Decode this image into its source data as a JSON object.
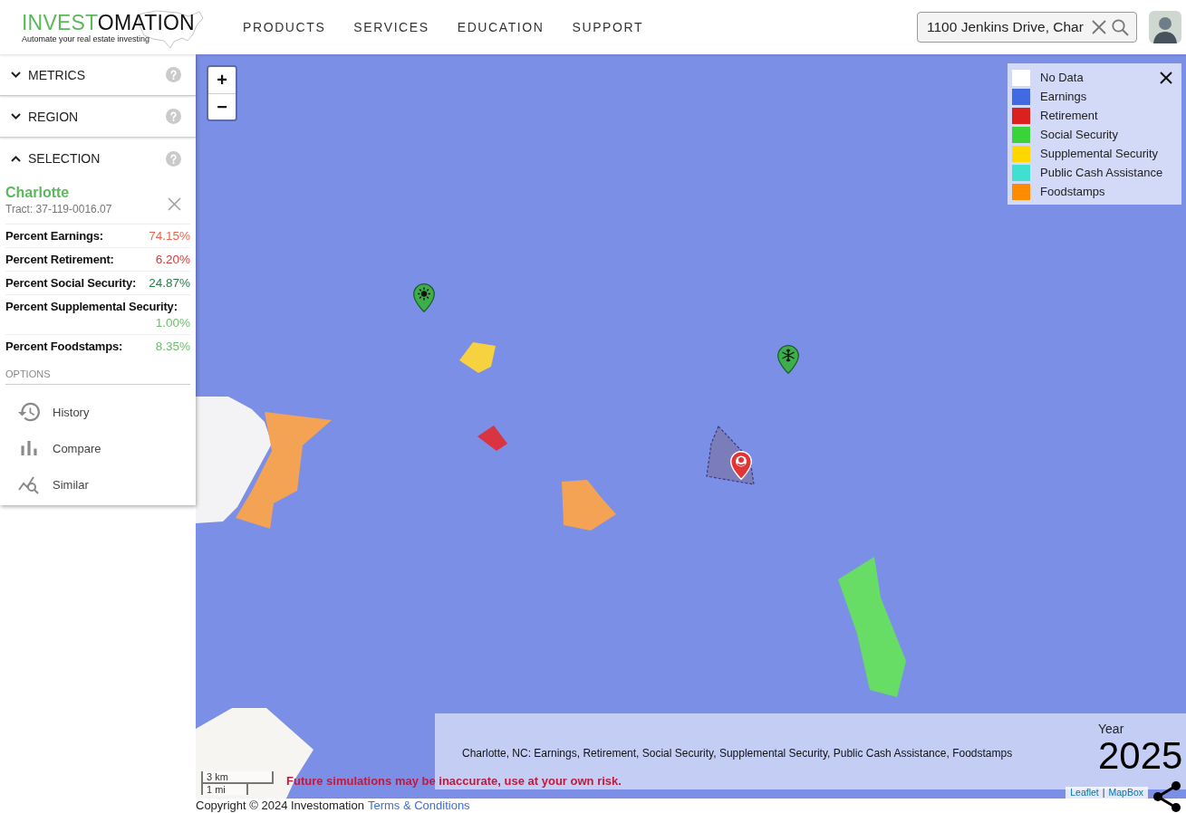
{
  "header": {
    "logo": {
      "wordmark_accent": "INVEST",
      "wordmark_rest": "OMATION",
      "tagline": "Automate your real estate investing"
    },
    "nav": [
      {
        "label": "PRODUCTS"
      },
      {
        "label": "SERVICES"
      },
      {
        "label": "EDUCATION"
      },
      {
        "label": "SUPPORT"
      }
    ],
    "search": {
      "value": "1100 Jenkins Drive, Char"
    }
  },
  "sidebar": {
    "sections": [
      {
        "label": "METRICS",
        "expanded": false
      },
      {
        "label": "REGION",
        "expanded": false
      },
      {
        "label": "SELECTION",
        "expanded": true
      }
    ],
    "selection": {
      "name": "Charlotte",
      "tract": "Tract: 37-119-0016.07",
      "metrics": [
        {
          "label": "Percent Earnings:",
          "value": "74.15%",
          "color": "#e8664f"
        },
        {
          "label": "Percent Retirement:",
          "value": "6.20%",
          "color": "#d63a3a"
        },
        {
          "label": "Percent Social Security:",
          "value": "24.87%",
          "color": "#2a7a4e"
        },
        {
          "label": "Percent Supplemental Security:",
          "value": "1.00%",
          "color": "#6cbf6a"
        },
        {
          "label": "Percent Foodstamps:",
          "value": "8.35%",
          "color": "#6cbf6a"
        }
      ]
    },
    "options_heading": "OPTIONS",
    "options": [
      {
        "label": "History",
        "kind": "history"
      },
      {
        "label": "Compare",
        "kind": "compare"
      },
      {
        "label": "Similar",
        "kind": "similar"
      }
    ]
  },
  "map": {
    "zoom": {
      "in": "+",
      "out": "−"
    },
    "legend": [
      {
        "label": "No Data",
        "color": "#ffffff"
      },
      {
        "label": "Earnings",
        "color": "#4169e1"
      },
      {
        "label": "Retirement",
        "color": "#dc1f1f"
      },
      {
        "label": "Social Security",
        "color": "#3ad43a"
      },
      {
        "label": "Supplemental Security",
        "color": "#ffd700"
      },
      {
        "label": "Public Cash Assistance",
        "color": "#40e0d0"
      },
      {
        "label": "Foodstamps",
        "color": "#ff8c00"
      }
    ],
    "info": {
      "description": "Charlotte, NC: Earnings, Retirement, Social Security, Supplemental Security, Public Cash Assistance, Foodstamps",
      "year_label": "Year",
      "year": "2025"
    },
    "scale": [
      "3 km",
      "1 mi"
    ],
    "warning": "Future simulations may be inaccurate, use at your own risk.",
    "attribution": {
      "links": [
        "Leaflet",
        "MapBox"
      ],
      "separator": "|"
    }
  },
  "footer": {
    "copyright": "Copyright © 2024 Investomation",
    "link": "Terms & Conditions"
  }
}
